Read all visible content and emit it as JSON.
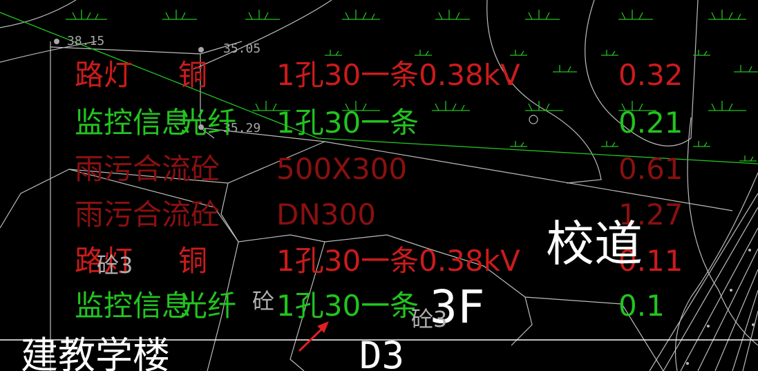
{
  "elevations": [
    "38.15",
    "35.05",
    "35.29"
  ],
  "rows": [
    {
      "name": "路灯",
      "material": "铜",
      "spec": "1孔30一条0.38kV",
      "value": "0.32"
    },
    {
      "name": "监控信息",
      "material": "光纤",
      "spec": "1孔30一条",
      "value": "0.21"
    },
    {
      "name": "雨污合流砼",
      "material": "",
      "spec": "500X300",
      "value": "0.61"
    },
    {
      "name": "雨污合流砼",
      "material": "",
      "spec": "DN300",
      "value": "1.27"
    },
    {
      "name": "路灯",
      "material": "铜",
      "spec": "1孔30一条0.38kV",
      "value": "0.11"
    },
    {
      "name": "监控信息",
      "material": "光纤",
      "spec": "1孔30一条",
      "value": "0.1"
    }
  ],
  "labels": {
    "road": "校道",
    "floors": "3F",
    "concrete_1": "砼3",
    "concrete_2": "砼",
    "concrete_3": "砼3",
    "building": "建教学楼",
    "block": "D3"
  },
  "colors": {
    "background": "#000000",
    "red": "#cc1b1b",
    "dark_red": "#8a1010",
    "green": "#22c41f",
    "white": "#ffffff",
    "linework": "#bdbdbd",
    "pointer": "#e02020"
  },
  "icons": [
    "grass-symbol-icon",
    "survey-point-icon",
    "red-arrow-cursor-icon"
  ]
}
